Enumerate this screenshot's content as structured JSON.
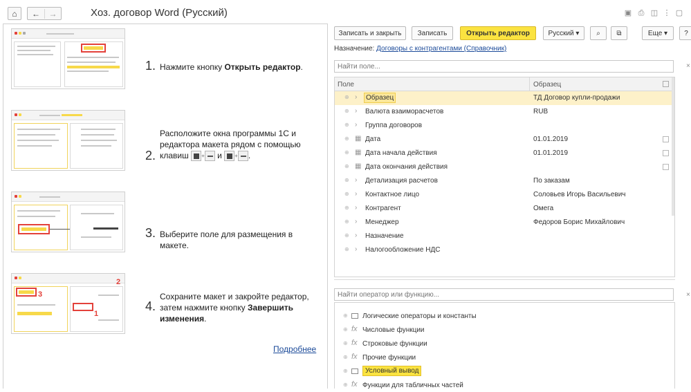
{
  "window": {
    "title": "Хоз. договор Word (Русский)",
    "nav_back": "←",
    "nav_forward": "→",
    "home_icon": "home-icon"
  },
  "steps": [
    {
      "num": "1.",
      "text_pre": "Нажмите кнопку ",
      "text_bold": "Открыть редактор",
      "text_post": "."
    },
    {
      "num": "2.",
      "text": "Расположите окна программы 1С и редактора макета рядом с помощью клавиш",
      "and": "и"
    },
    {
      "num": "3.",
      "text": "Выберите поле для размещения в макете."
    },
    {
      "num": "4.",
      "text_pre": "Сохраните макет и закройте редактор, затем нажмите кнопку ",
      "text_bold": "Завершить изменения",
      "text_post": "."
    }
  ],
  "thumb_numbers": {
    "one": "1",
    "two": "2",
    "three": "3"
  },
  "more_link": "Подробнее",
  "toolbar": {
    "save_close": "Записать и закрыть",
    "save": "Записать",
    "open_editor": "Открыть редактор",
    "language": "Русский",
    "more": "Еще",
    "help": "?"
  },
  "assignment": {
    "label": "Назначение:",
    "link": "Договоры с контрагентами (Справочник)"
  },
  "field_search": {
    "placeholder": "Найти поле...",
    "clear": "×"
  },
  "fields_table": {
    "col_field": "Поле",
    "col_sample": "Образец",
    "rows": [
      {
        "name": "Образец",
        "value": "ТД Договор купли-продажи",
        "icon": "chevron",
        "selected": true
      },
      {
        "name": "Валюта взаиморасчетов",
        "value": "RUB",
        "icon": "chevron"
      },
      {
        "name": "Группа договоров",
        "value": "",
        "icon": "chevron"
      },
      {
        "name": "Дата",
        "value": "01.01.2019",
        "icon": "calendar"
      },
      {
        "name": "Дата начала действия",
        "value": "01.01.2019",
        "icon": "calendar"
      },
      {
        "name": "Дата окончания действия",
        "value": "",
        "icon": "calendar"
      },
      {
        "name": "Детализация расчетов",
        "value": "По заказам",
        "icon": "chevron"
      },
      {
        "name": "Контактное лицо",
        "value": "Соловьев Игорь Васильевич",
        "icon": "chevron"
      },
      {
        "name": "Контрагент",
        "value": "Омега",
        "icon": "chevron"
      },
      {
        "name": "Менеджер",
        "value": "Федоров Борис Михайлович",
        "icon": "chevron"
      },
      {
        "name": "Назначение",
        "value": "",
        "icon": "chevron"
      },
      {
        "name": "Налогообложение НДС",
        "value": "",
        "icon": "chevron"
      }
    ]
  },
  "operator_search": {
    "placeholder": "Найти оператор или функцию...",
    "clear": "×"
  },
  "operators": [
    {
      "name": "Логические операторы и константы",
      "icon": "folder"
    },
    {
      "name": "Числовые функции",
      "icon": "fx"
    },
    {
      "name": "Строковые функции",
      "icon": "fx"
    },
    {
      "name": "Прочие функции",
      "icon": "fx"
    },
    {
      "name": "Условный вывод",
      "icon": "folder",
      "highlighted": true
    },
    {
      "name": "Функции для табличных частей",
      "icon": "fx"
    }
  ],
  "colors": {
    "accent": "#fbe340",
    "selection": "#fdf1c9",
    "link": "#1b4a99",
    "marker": "#e3413a"
  }
}
